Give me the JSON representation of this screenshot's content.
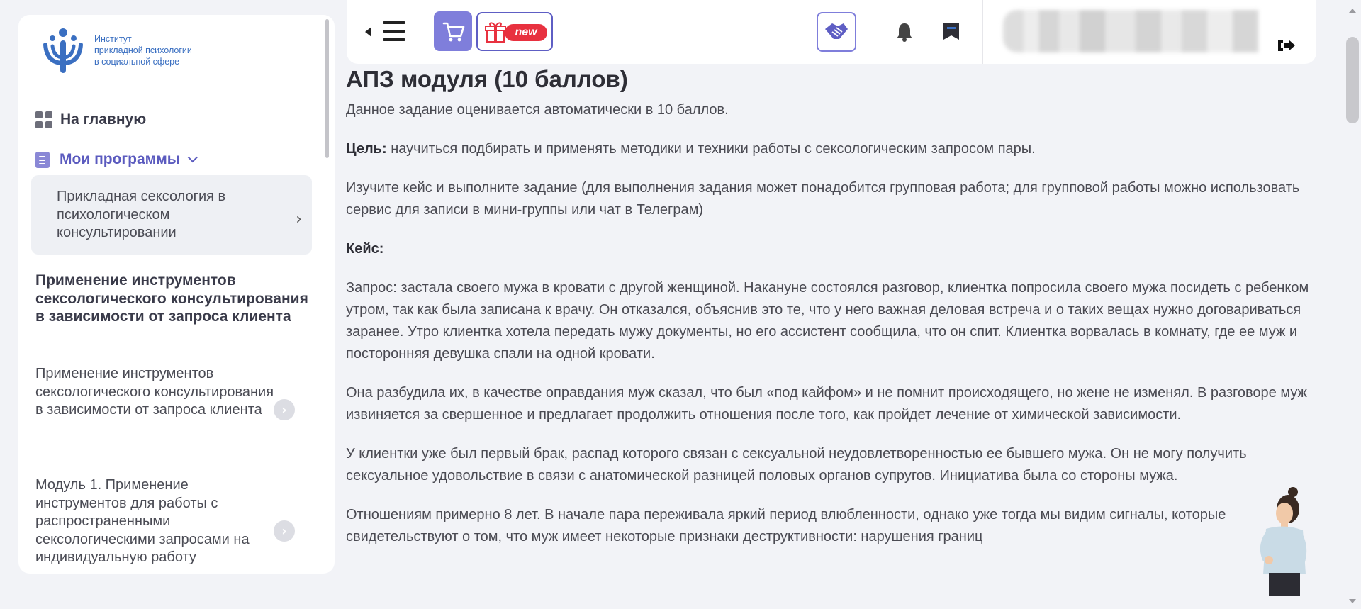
{
  "sidebar": {
    "logo": {
      "line1": "Институт",
      "line2": "прикладной психологии",
      "line3": "в социальной сфере"
    },
    "home_label": "На главную",
    "programs_label": "Мои программы",
    "program_name": "Прикладная сексология в психологическом консультировании",
    "section_title": "Применение инструментов сексологического консультирования в зависимости от запроса клиента",
    "lessons": [
      {
        "label": "Применение инструментов сексологического консультирования в зависимости от запроса клиента"
      },
      {
        "label": "Модуль 1. Применение инструментов для работы с распространенными сексологическими запросами на индивидуальную работу"
      }
    ]
  },
  "topbar": {
    "new_badge": "new"
  },
  "content": {
    "title": "АПЗ модуля (10 баллов)",
    "intro": "Данное задание оценивается автоматически в 10 баллов.",
    "goal_label": "Цель:",
    "goal_text": " научиться подбирать и применять методики и техники работы с сексологическим запросом пары.",
    "instruction": "Изучите кейс и выполните задание (для выполнения задания может понадобится групповая работа; для групповой работы можно использовать сервис для записи в мини-группы или чат в Телеграм)",
    "case_label": "Кейс:",
    "paragraphs": [
      "Запрос: застала своего мужа в кровати с другой женщиной. Накануне состоялся разговор, клиентка попросила своего мужа посидеть с ребенком утром, так как была записана к врачу. Он отказался, объяснив это те, что у него важная деловая встреча и о таких вещах нужно договариваться заранее. Утро клиентка хотела передать мужу документы, но его ассистент сообщила, что он спит. Клиентка ворвалась в комнату, где ее муж и посторонняя девушка спали на одной кровати.",
      "Она разбудила их, в качестве оправдания муж сказал, что был «под кайфом» и не помнит происходящего, но жене не изменял. В разговоре муж извиняется за свершенное и предлагает продолжить отношения после того, как пройдет лечение от химической зависимости.",
      "У клиентки уже был первый брак, распад которого связан с сексуальной неудовлетворенностью ее бывшего мужа. Он не могу получить сексуальное удовольствие в связи с анатомической разницей половых органов супругов. Инициатива была со стороны мужа.",
      "Отношениям примерно 8 лет. В начале пара переживала яркий период влюбленности, однако уже тогда мы видим сигналы, которые свидетельствуют о том, что муж имеет некоторые признаки деструктивности: нарушения границ"
    ]
  },
  "colors": {
    "accent": "#7f7edb",
    "badge_red": "#e8313f",
    "logo_blue": "#3a6fc1"
  },
  "icons": {
    "cart": "cart-icon",
    "gift": "gift-icon",
    "handshake": "handshake-icon",
    "bell": "bell-icon",
    "bookmark": "bookmark-icon",
    "logout": "logout-icon"
  }
}
